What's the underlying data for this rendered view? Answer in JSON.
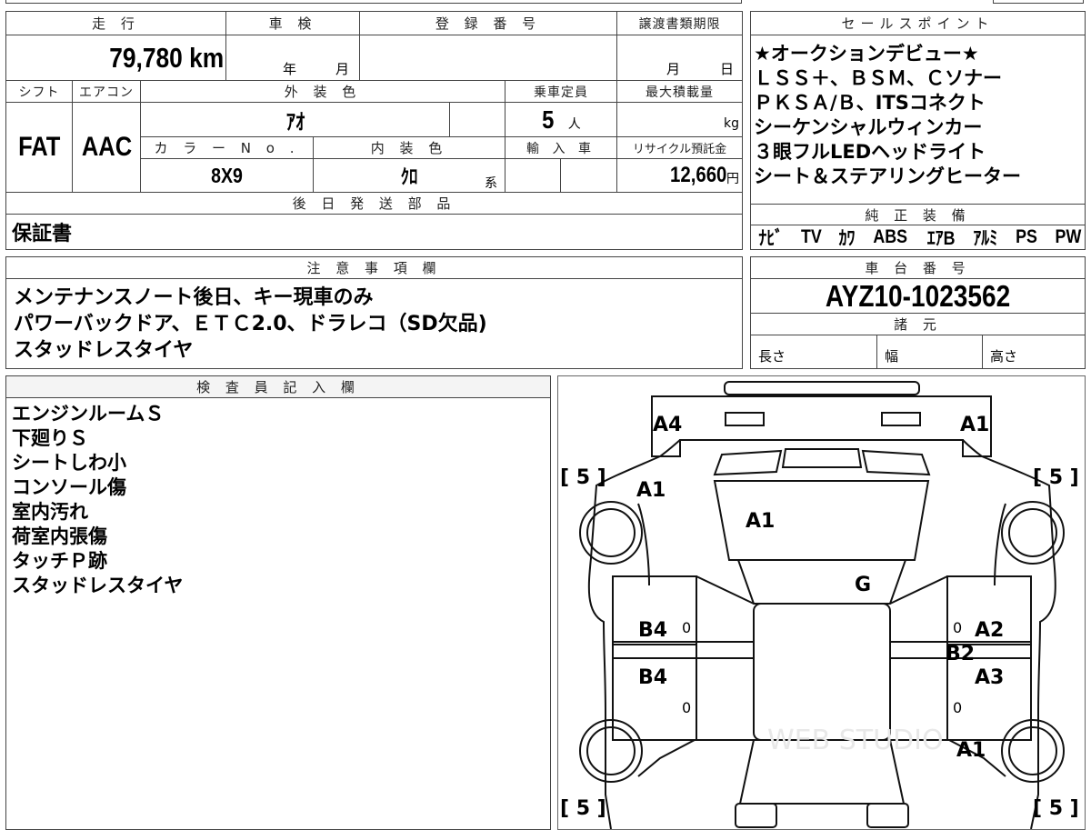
{
  "vehicle_info": {
    "mileage_label": "走 行",
    "mileage_value": "79,780 km",
    "inspection_label": "車 検",
    "inspection_year_unit": "年",
    "inspection_month_unit": "月",
    "registration_label": "登 録 番 号",
    "registration_value": "",
    "transfer_deadline_label": "譲渡書類期限",
    "transfer_month_unit": "月",
    "transfer_day_unit": "日",
    "shift_label": "シフト",
    "shift_value": "FAT",
    "aircon_label": "エアコン",
    "aircon_value": "AAC",
    "exterior_color_label": "外 装 色",
    "exterior_color_value": "ｱｵ",
    "capacity_label": "乗車定員",
    "capacity_value": "5",
    "capacity_unit": "人",
    "max_load_label": "最大積載量",
    "max_load_unit": "kg",
    "color_no_label": "カ ラ ー N o .",
    "color_no_value": "8X9",
    "interior_color_label": "内 装 色",
    "interior_color_value": "ｸﾛ",
    "interior_color_suffix": "系",
    "import_label": "輸 入 車",
    "recycle_label": "リサイクル預託金",
    "recycle_value": "12,660",
    "recycle_unit": "円",
    "later_parts_label": "後 日 発 送 部 品",
    "later_parts_value": "保証書"
  },
  "sales_points": {
    "label": "セールスポイント",
    "lines": [
      "★オークションデビュー★",
      "ＬＳＳ＋、ＢＳＭ、Ｃソナー",
      "ＰＫＳＡ/Ｂ、ITSコネクト",
      "シーケンシャルウィンカー",
      "３眼フルLEDヘッドライト",
      "シート＆ステアリングヒーター"
    ]
  },
  "genuine_equipment": {
    "label": "純 正 装 備",
    "items": [
      "ﾅﾋﾞ",
      "TV",
      "ｶﾜ",
      "ABS",
      "ｴｱB",
      "ｱﾙﾐ",
      "PS",
      "PW"
    ]
  },
  "notes": {
    "label": "注 意 事 項 欄",
    "lines": [
      "メンテナンスノート後日、キー現車のみ",
      "パワーバックドア、ＥＴＣ2.0、ドラレコ（SD欠品)",
      "スタッドレスタイヤ"
    ]
  },
  "chassis": {
    "label": "車 台 番 号",
    "value": "AYZ10-1023562"
  },
  "specs": {
    "label": "諸 元",
    "length_label": "長さ",
    "width_label": "幅",
    "height_label": "高さ"
  },
  "inspector": {
    "label": "検 査 員 記 入 欄",
    "lines": [
      "エンジンルームＳ",
      "下廻りＳ",
      "シートしわ小",
      "コンソール傷",
      "室内汚れ",
      "荷室内張傷",
      "タッチＰ跡",
      "スタッドレスタイヤ"
    ]
  },
  "diagram": {
    "marks": {
      "rear_left": "A4",
      "rear_right": "A1",
      "rear_left_quarter": "A1",
      "back_glass": "A1",
      "roof": "G",
      "left_rear_door": "B4",
      "left_front_door": "B4",
      "right_rear_door": "A2",
      "right_center": "B2",
      "right_front_door": "A3",
      "right_front_fender": "A1"
    },
    "tire_tl": "[ 5 ]",
    "tire_tr": "[ 5 ]",
    "tire_bl": "[ 5 ]",
    "tire_br": "[ 5 ]",
    "door_zero": "0",
    "watermark": "WEB STUDIO"
  }
}
